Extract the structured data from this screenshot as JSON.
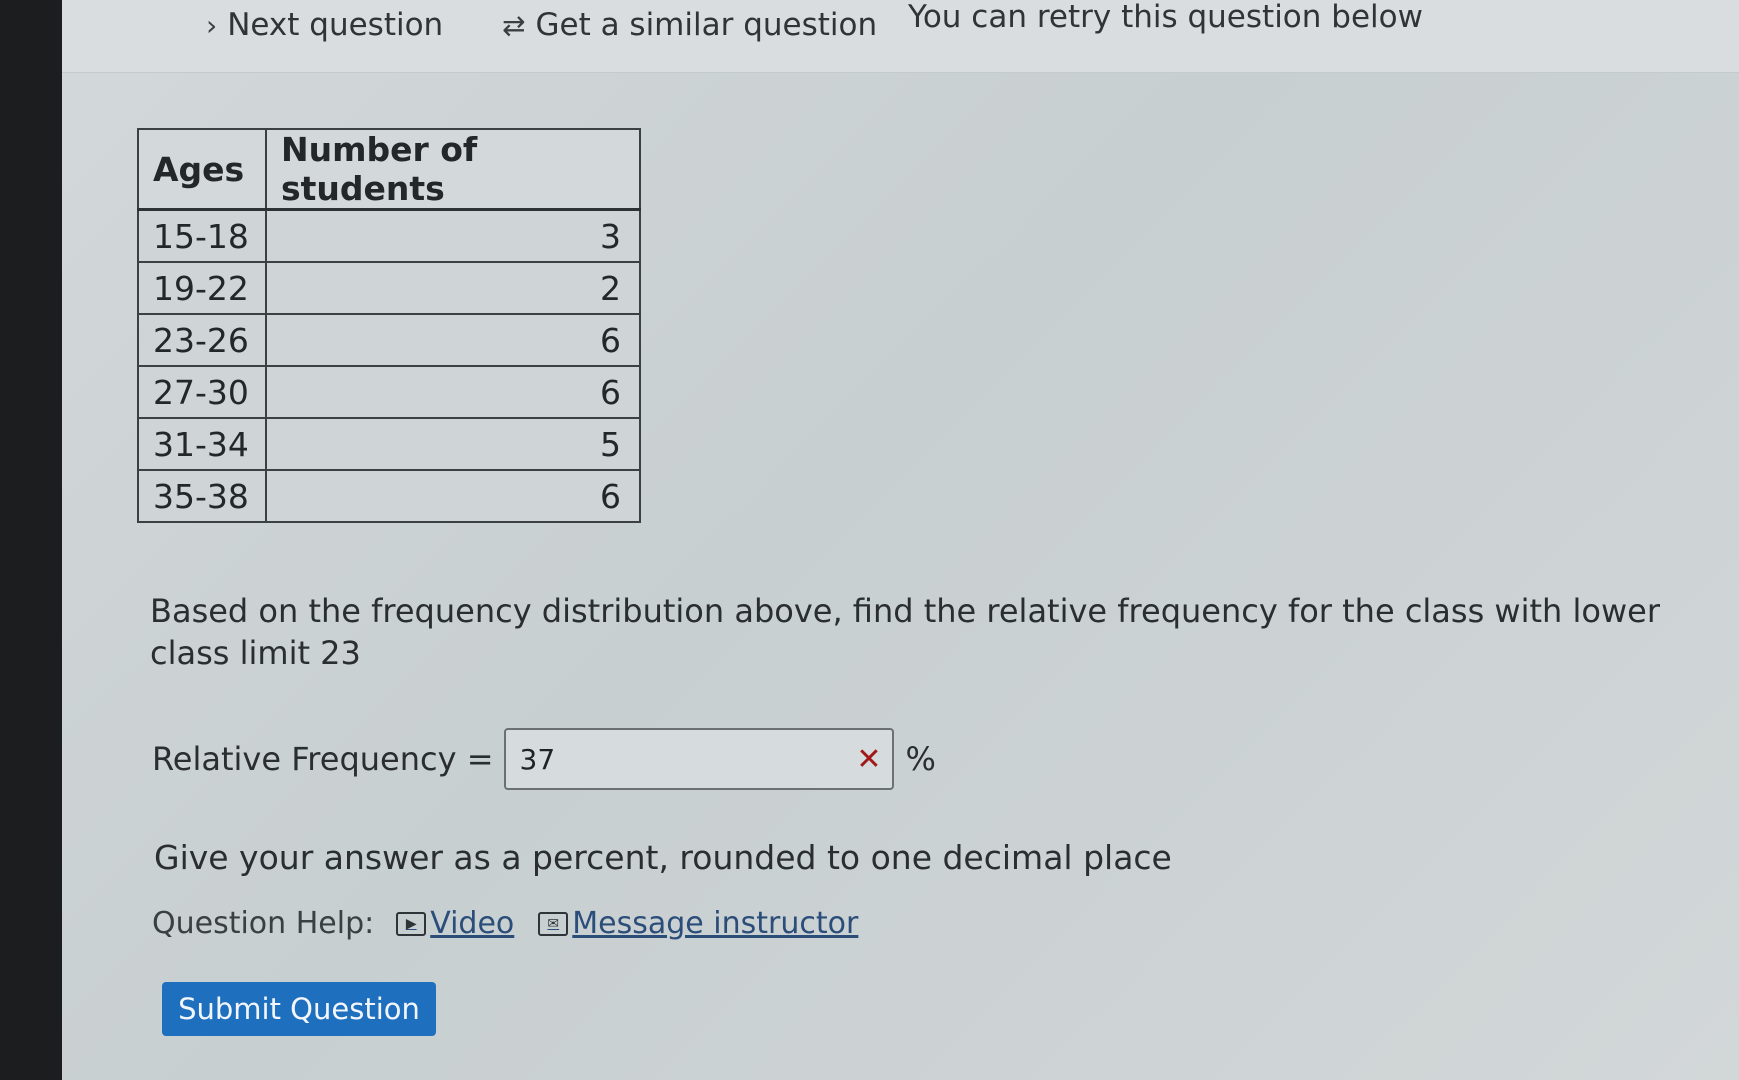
{
  "topbar": {
    "next_label": "Next question",
    "next_icon": "chevron-right-icon",
    "similar_label": "Get a similar question",
    "similar_icon": "refresh-icon",
    "retry_text": "You can retry this question below"
  },
  "table": {
    "headers": [
      "Ages",
      "Number of students"
    ],
    "rows": [
      {
        "age": "15-18",
        "count": "3"
      },
      {
        "age": "19-22",
        "count": "2"
      },
      {
        "age": "23-26",
        "count": "6"
      },
      {
        "age": "27-30",
        "count": "6"
      },
      {
        "age": "31-34",
        "count": "5"
      },
      {
        "age": "35-38",
        "count": "6"
      }
    ]
  },
  "question": {
    "text": "Based on the frequency distribution above, find the relative frequency for the class with lower class limit 23",
    "answer_label": "Relative Frequency =",
    "answer_value": "37",
    "answer_status_icon": "incorrect-x-icon",
    "unit": "%",
    "hint": "Give your answer as a percent, rounded to one decimal place"
  },
  "help": {
    "label": "Question Help:",
    "video_label": "Video",
    "message_label": "Message instructor"
  },
  "submit_label": "Submit Question",
  "colors": {
    "submit_bg": "#1f6fbf",
    "incorrect": "#a01818",
    "link": "#2b4d7a"
  }
}
